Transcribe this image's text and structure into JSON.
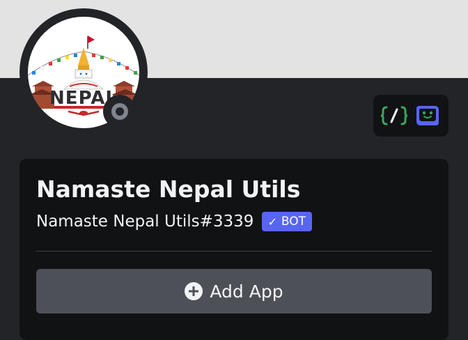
{
  "profile": {
    "display_name": "Namaste Nepal Utils",
    "username": "Namaste Nepal Utils#3339",
    "bot_tag": "BOT",
    "bot_tag_check": "✓",
    "status": "offline",
    "avatar_text": "NEPAL",
    "banner_color": "#e3e3e3"
  },
  "badges": [
    {
      "icon": "slash-commands-icon",
      "label": "{/}"
    },
    {
      "icon": "bot-face-icon"
    }
  ],
  "actions": {
    "add_app_label": "Add App",
    "add_app_icon": "plus-circle-icon"
  },
  "colors": {
    "background": "#232428",
    "card": "#111214",
    "accent": "#5865f2",
    "button": "#4e5058",
    "slash_badge": "#3ba55c"
  }
}
